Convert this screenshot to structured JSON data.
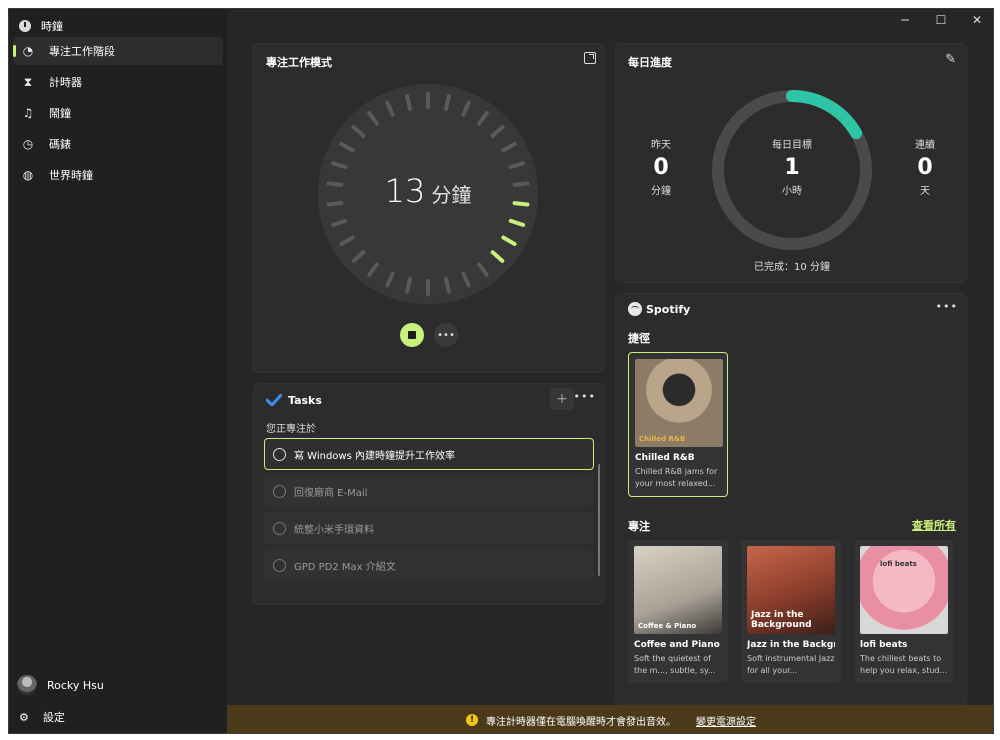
{
  "app": {
    "title": "時鐘",
    "icon": "clock-app-icon"
  },
  "window_controls": {
    "minimize": "─",
    "maximize": "☐",
    "close": "✕"
  },
  "sidebar": {
    "items": [
      {
        "label": "專注工作階段",
        "icon": "focus-icon",
        "active": true
      },
      {
        "label": "計時器",
        "icon": "hourglass-icon",
        "active": false
      },
      {
        "label": "鬧鐘",
        "icon": "bell-icon",
        "active": false
      },
      {
        "label": "碼錶",
        "icon": "stopwatch-icon",
        "active": false
      },
      {
        "label": "世界時鐘",
        "icon": "globe-icon",
        "active": false
      }
    ],
    "user": "Rocky Hsu",
    "settings": "設定"
  },
  "focus": {
    "title": "專注工作模式",
    "minutes": "13",
    "unit": "分鐘",
    "progress_ticks_lit": 4
  },
  "daily": {
    "title": "每日進度",
    "yesterday": {
      "label": "昨天",
      "value": "0",
      "unit": "分鐘"
    },
    "goal": {
      "label": "每日目標",
      "value": "1",
      "unit": "小時"
    },
    "streak": {
      "label": "連續",
      "value": "0",
      "unit": "天"
    },
    "completed": "已完成：10 分鐘",
    "progress_fraction": 0.167,
    "accent": "#2ec4a6"
  },
  "tasks": {
    "title": "Tasks",
    "focusing_on": "您正專注於",
    "items": [
      {
        "text": "寫 Windows 內建時鐘提升工作效率",
        "selected": true
      },
      {
        "text": "回復廠商 E-Mail",
        "selected": false
      },
      {
        "text": "統整小米手環資料",
        "selected": false
      },
      {
        "text": "GPD PD2 Max 介紹文",
        "selected": false
      }
    ]
  },
  "spotify": {
    "brand": "Spotify",
    "shortcuts_label": "捷徑",
    "focus_label": "專注",
    "see_all": "查看所有",
    "shortcut": {
      "cover_text": "Chilled R&B",
      "name": "Chilled R&B",
      "desc": "Chilled R&B jams for your most relaxed..."
    },
    "focus_playlists": [
      {
        "cover_text": "Coffee & Piano",
        "name": "Coffee and Piano",
        "desc": "Soft the quietest of the m..., subtle, sy..."
      },
      {
        "cover_text": "Jazz in the Background",
        "name": "Jazz in the Backgr...",
        "desc": "Soft instrumental Jazz for all your..."
      },
      {
        "cover_text": "lofi beats",
        "name": "lofi beats",
        "desc": "The chillest beats to help you relax, stud..."
      }
    ]
  },
  "banner": {
    "message": "專注計時器僅在電腦喚醒時才會發出音效。",
    "link": "變更電源設定"
  },
  "colors": {
    "accent": "#c8f07a",
    "background": "#202020",
    "card": "#2c2c2c"
  }
}
